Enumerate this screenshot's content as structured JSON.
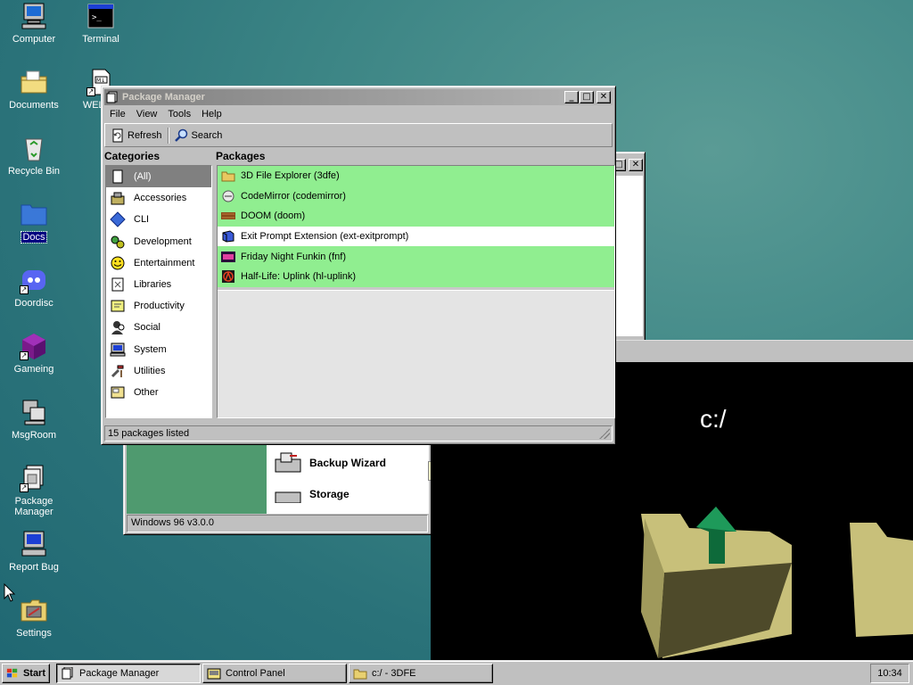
{
  "desktop": {
    "icons": [
      {
        "label": "Computer",
        "icon": "computer-icon"
      },
      {
        "label": "Terminal",
        "icon": "terminal-icon"
      },
      {
        "label": "Documents",
        "icon": "documents-folder-icon"
      },
      {
        "label": "WELCO",
        "icon": "markdown-file-icon"
      },
      {
        "label": "Recycle Bin",
        "icon": "recycle-bin-icon"
      },
      {
        "label": "Docs",
        "icon": "folder-icon"
      },
      {
        "label": "Doordisc",
        "icon": "doordisc-icon"
      },
      {
        "label": "Gameing",
        "icon": "gaming-cube-icon"
      },
      {
        "label": "MsgRoom",
        "icon": "msgroom-icon"
      },
      {
        "label": "Package",
        "label2": "Manager",
        "icon": "package-manager-icon"
      },
      {
        "label": "Report Bug",
        "icon": "report-bug-icon"
      },
      {
        "label": "Settings",
        "icon": "settings-icon"
      }
    ]
  },
  "package_manager": {
    "title": "Package Manager",
    "menu": [
      "File",
      "View",
      "Tools",
      "Help"
    ],
    "toolbar": {
      "refresh_label": "Refresh",
      "search_label": "Search"
    },
    "categories_header": "Categories",
    "packages_header": "Packages",
    "categories": [
      {
        "label": "(All)",
        "icon": "all-icon",
        "selected": true
      },
      {
        "label": "Accessories",
        "icon": "accessories-icon"
      },
      {
        "label": "CLI",
        "icon": "cli-diamond-icon"
      },
      {
        "label": "Development",
        "icon": "development-icon"
      },
      {
        "label": "Entertainment",
        "icon": "smiley-icon"
      },
      {
        "label": "Libraries",
        "icon": "libraries-icon"
      },
      {
        "label": "Productivity",
        "icon": "productivity-icon"
      },
      {
        "label": "Social",
        "icon": "social-icon"
      },
      {
        "label": "System",
        "icon": "system-computer-icon"
      },
      {
        "label": "Utilities",
        "icon": "utilities-icon"
      },
      {
        "label": "Other",
        "icon": "other-icon"
      }
    ],
    "packages": [
      {
        "label": "3D File Explorer (3dfe)",
        "icon": "folder-icon",
        "installed": true
      },
      {
        "label": "CodeMirror (codemirror)",
        "icon": "codemirror-icon",
        "installed": true
      },
      {
        "label": "DOOM (doom)",
        "icon": "doom-icon",
        "installed": true
      },
      {
        "label": "Exit Prompt Extension (ext-exitprompt)",
        "icon": "cube-icon",
        "installed": false
      },
      {
        "label": "Friday Night Funkin (fnf)",
        "icon": "fnf-icon",
        "installed": true
      },
      {
        "label": "Half-Life: Uplink (hl-uplink)",
        "icon": "half-life-icon",
        "installed": true
      }
    ],
    "status": "15 packages listed"
  },
  "control_panel": {
    "items": [
      "Backup Wizard",
      "Storage"
    ],
    "status": "Windows 96 v3.0.0"
  },
  "file_explorer_3d": {
    "path": "c:/"
  },
  "taskbar": {
    "start_label": "Start",
    "tasks": [
      {
        "label": "Package Manager",
        "active": true
      },
      {
        "label": "Control Panel",
        "active": false
      },
      {
        "label": "c:/ - 3DFE",
        "active": false
      }
    ],
    "clock": "10:34"
  }
}
